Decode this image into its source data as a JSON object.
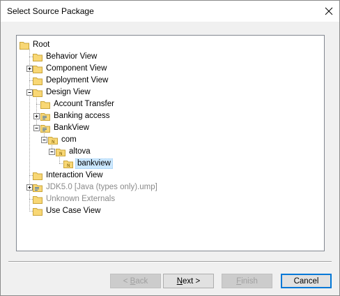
{
  "window": {
    "title": "Select Source Package"
  },
  "tree": {
    "nodes": [
      {
        "label": "Root",
        "icon": "folder-icon",
        "expander": "none",
        "state": "normal"
      },
      {
        "label": "Behavior View",
        "icon": "folder-icon",
        "expander": "none",
        "state": "normal"
      },
      {
        "label": "Component View",
        "icon": "folder-icon",
        "expander": "plus",
        "state": "normal"
      },
      {
        "label": "Deployment View",
        "icon": "folder-icon",
        "expander": "none",
        "state": "normal"
      },
      {
        "label": "Design View",
        "icon": "folder-icon",
        "expander": "minus",
        "state": "normal"
      },
      {
        "label": "Account Transfer",
        "icon": "folder-icon",
        "expander": "none",
        "state": "normal"
      },
      {
        "label": "Banking access",
        "icon": "package-folder-icon",
        "expander": "plus",
        "state": "normal"
      },
      {
        "label": "BankView",
        "icon": "package-folder-icon",
        "expander": "minus",
        "state": "normal"
      },
      {
        "label": "com",
        "icon": "namespace-folder-icon",
        "expander": "minus",
        "state": "normal"
      },
      {
        "label": "altova",
        "icon": "namespace-folder-icon",
        "expander": "minus",
        "state": "normal"
      },
      {
        "label": "bankview",
        "icon": "namespace-folder-icon",
        "expander": "none",
        "state": "selected"
      },
      {
        "label": "Interaction View",
        "icon": "folder-icon",
        "expander": "none",
        "state": "normal"
      },
      {
        "label": "JDK5.0 [Java (types only).ump]",
        "icon": "package-folder-icon",
        "expander": "plus",
        "state": "dimmed"
      },
      {
        "label": "Unknown Externals",
        "icon": "folder-icon",
        "expander": "none",
        "state": "dimmed"
      },
      {
        "label": "Use Case View",
        "icon": "folder-icon",
        "expander": "none",
        "state": "normal"
      }
    ]
  },
  "buttons": {
    "back": {
      "prefix": "< ",
      "mnemonic": "B",
      "rest": "ack",
      "enabled": false
    },
    "next": {
      "mnemonic": "N",
      "rest": "ext >",
      "enabled": true
    },
    "finish": {
      "mnemonic": "F",
      "rest": "inish",
      "enabled": false
    },
    "cancel": {
      "label": "Cancel",
      "enabled": true
    }
  },
  "colors": {
    "folder_fill": "#f8d775",
    "folder_stroke": "#c9a43a",
    "selection": "#cce8ff",
    "default_button_border": "#0078d7"
  }
}
